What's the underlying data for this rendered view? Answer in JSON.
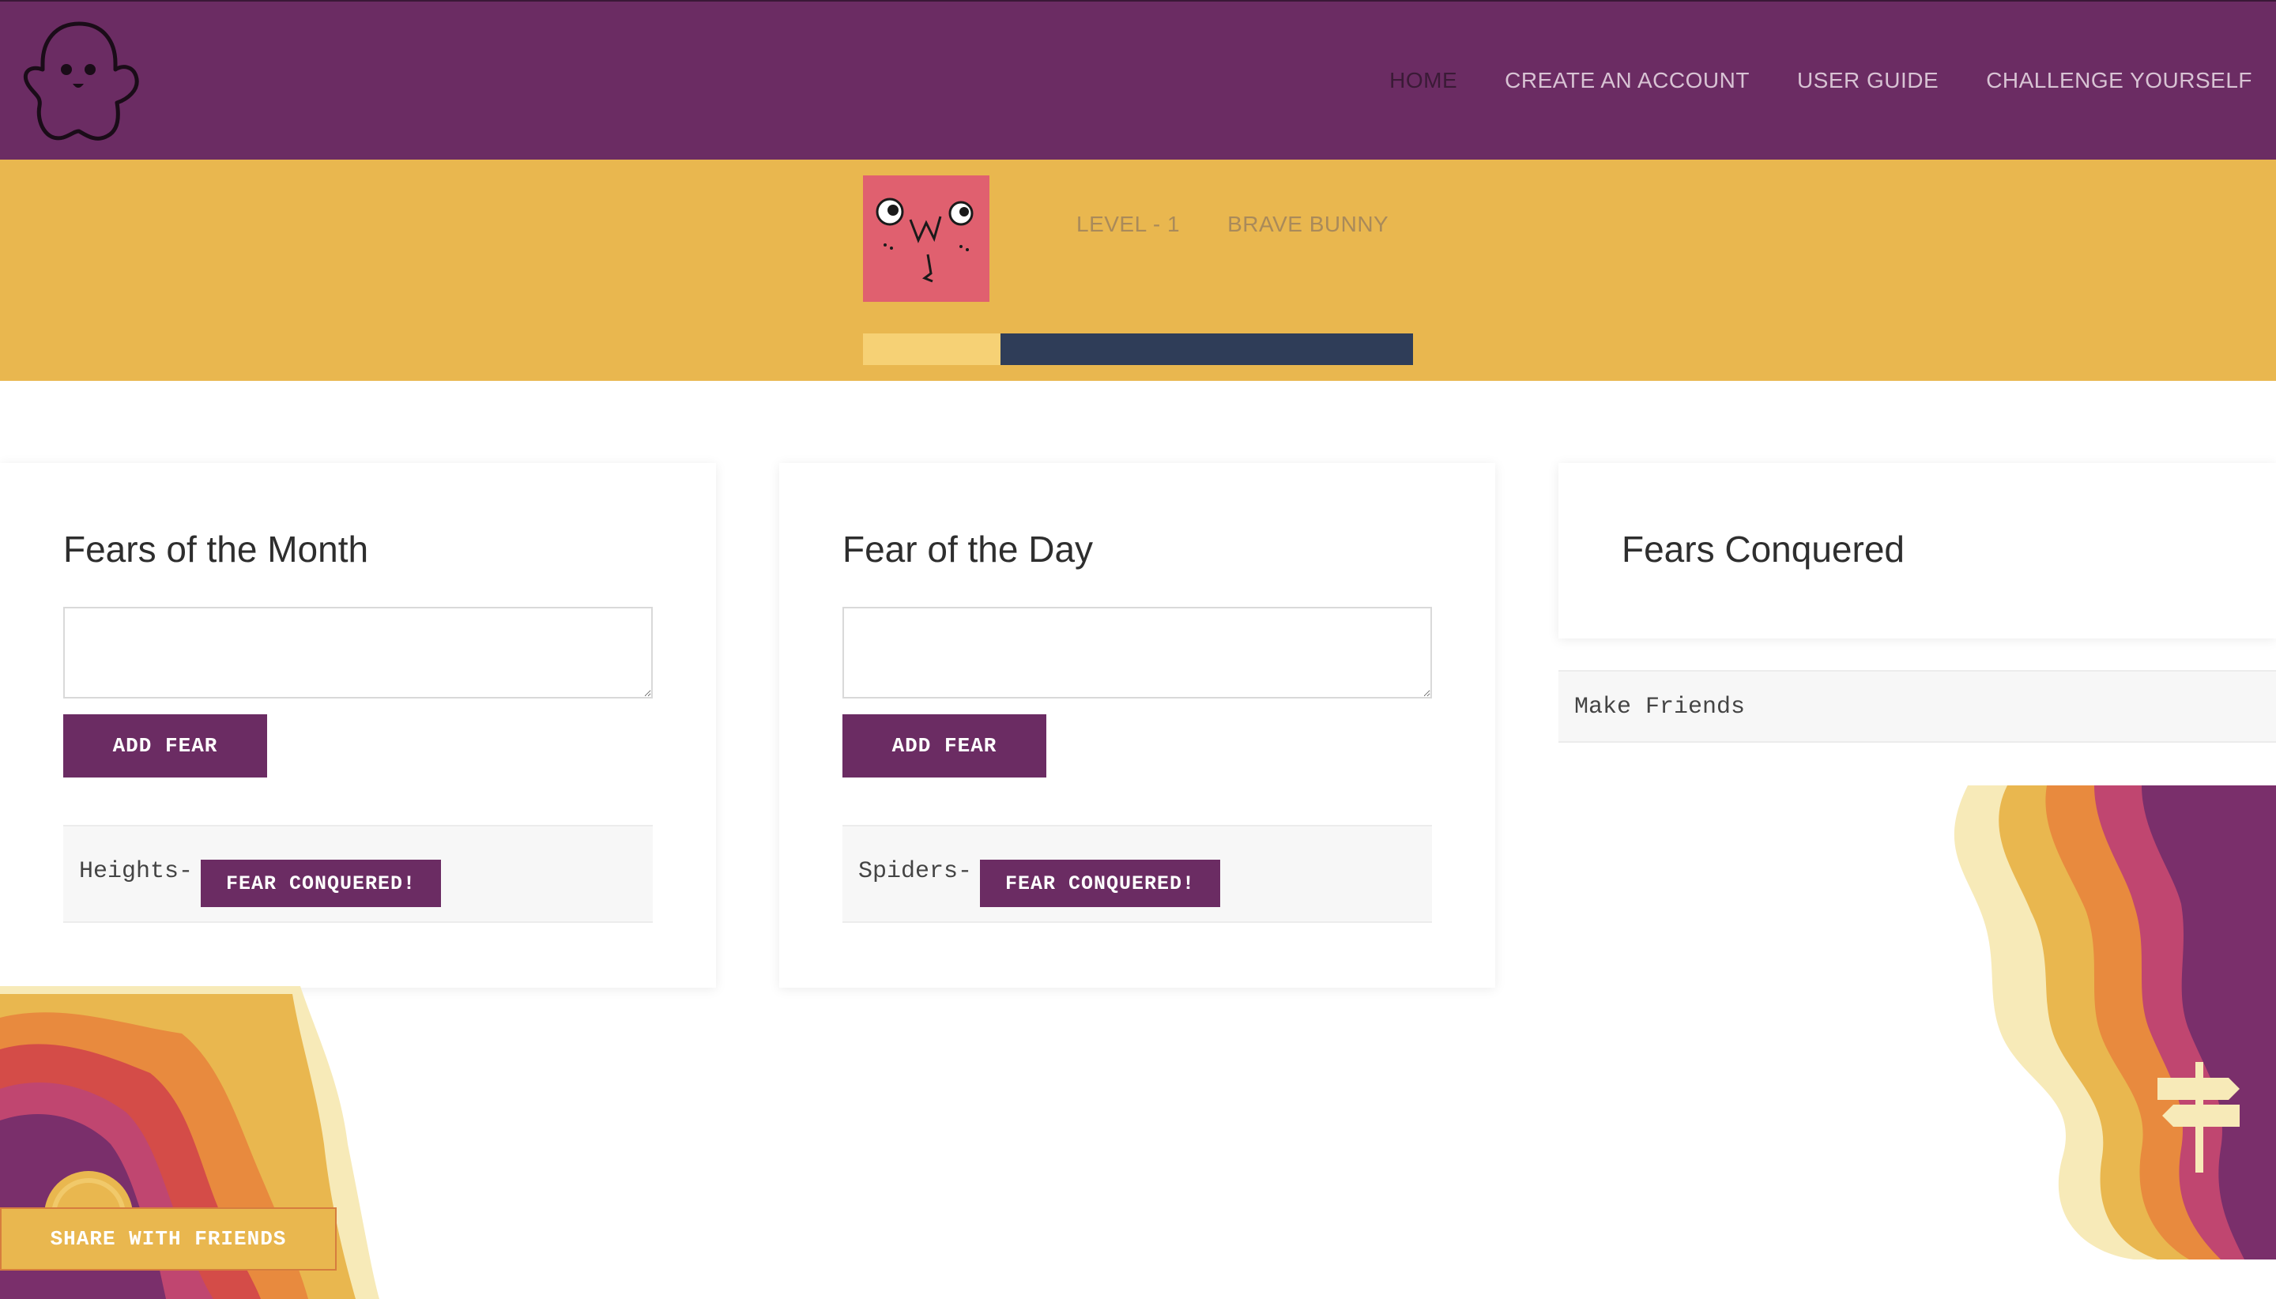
{
  "nav": {
    "items": [
      {
        "label": "HOME",
        "active": true
      },
      {
        "label": "CREATE AN ACCOUNT",
        "active": false
      },
      {
        "label": "USER GUIDE",
        "active": false
      },
      {
        "label": "CHALLENGE YOURSELF",
        "active": false
      }
    ]
  },
  "profile": {
    "level": "LEVEL - 1",
    "rank": "BRAVE BUNNY",
    "progress_fraction": 0.25
  },
  "month_card": {
    "title": "Fears of the Month",
    "add_label": "ADD FEAR",
    "fear": "Heights-",
    "conquer_label": "FEAR CONQUERED!"
  },
  "day_card": {
    "title": "Fear of the Day",
    "add_label": "ADD FEAR",
    "fear": "Spiders-",
    "conquer_label": "FEAR CONQUERED!"
  },
  "conquered_card": {
    "title": "Fears Conquered",
    "items": [
      "Make Friends"
    ]
  },
  "share": {
    "label": "SHARE WITH FRIENDS"
  },
  "colors": {
    "brand_purple": "#6b2c63",
    "mustard": "#e9b74f",
    "progress_track": "#2f3d58",
    "progress_fill": "#f6d175",
    "avatar_bg": "#e0606f"
  },
  "icons": [
    "ghost-icon",
    "avatar-face-icon",
    "sun-icon",
    "signpost-icon"
  ]
}
